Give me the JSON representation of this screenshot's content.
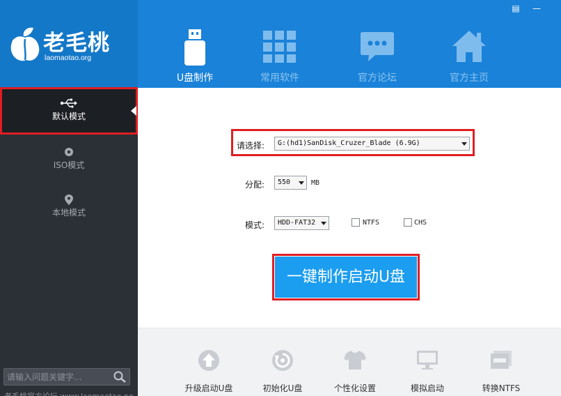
{
  "window": {
    "controls": {
      "menu_label": "▤",
      "minimize_label": "—"
    }
  },
  "brand": {
    "name": "老毛桃",
    "site": "laomaotao.org"
  },
  "sidebar": {
    "modes": [
      {
        "label": "默认模式",
        "icon": "usb-icon",
        "active": true
      },
      {
        "label": "ISO模式",
        "icon": "disc-icon",
        "active": false
      },
      {
        "label": "本地模式",
        "icon": "location-pin-icon",
        "active": false
      }
    ],
    "search": {
      "placeholder": "请输入问题关键字..."
    },
    "footer_text": "老毛桃官方论坛 www.laomaotao.net"
  },
  "nav": {
    "tabs": [
      {
        "label": "U盘制作",
        "icon": "usb-drive-icon",
        "active": true
      },
      {
        "label": "常用软件",
        "icon": "grid-icon",
        "active": false
      },
      {
        "label": "官方论坛",
        "icon": "chat-bubble-icon",
        "active": false
      },
      {
        "label": "官方主页",
        "icon": "home-icon",
        "active": false
      }
    ]
  },
  "form": {
    "device_label": "请选择:",
    "device_value": "G:(hd1)SanDisk_Cruzer_Blade (6.9G)",
    "allocate_label": "分配:",
    "allocate_value": "550",
    "allocate_unit": "MB",
    "mode_label": "模式:",
    "mode_value": "HDD-FAT32",
    "ntfs_label": "NTFS",
    "ntfs_checked": false,
    "chs_label": "CHS",
    "chs_checked": false,
    "make_button": "一键制作启动U盘"
  },
  "tools": [
    {
      "label": "升级启动U盘",
      "icon": "upgrade-arrow-icon"
    },
    {
      "label": "初始化U盘",
      "icon": "reset-icon"
    },
    {
      "label": "个性化设置",
      "icon": "tshirt-icon"
    },
    {
      "label": "模拟启动",
      "icon": "monitor-icon"
    },
    {
      "label": "转换NTFS",
      "icon": "ntfs-convert-icon"
    }
  ],
  "colors": {
    "header_blue": "#1a82d8",
    "logo_blue": "#1478c8",
    "sidebar_dark": "#2b2f36",
    "highlight_red": "#e01e22",
    "button_blue": "#1b9df0"
  }
}
